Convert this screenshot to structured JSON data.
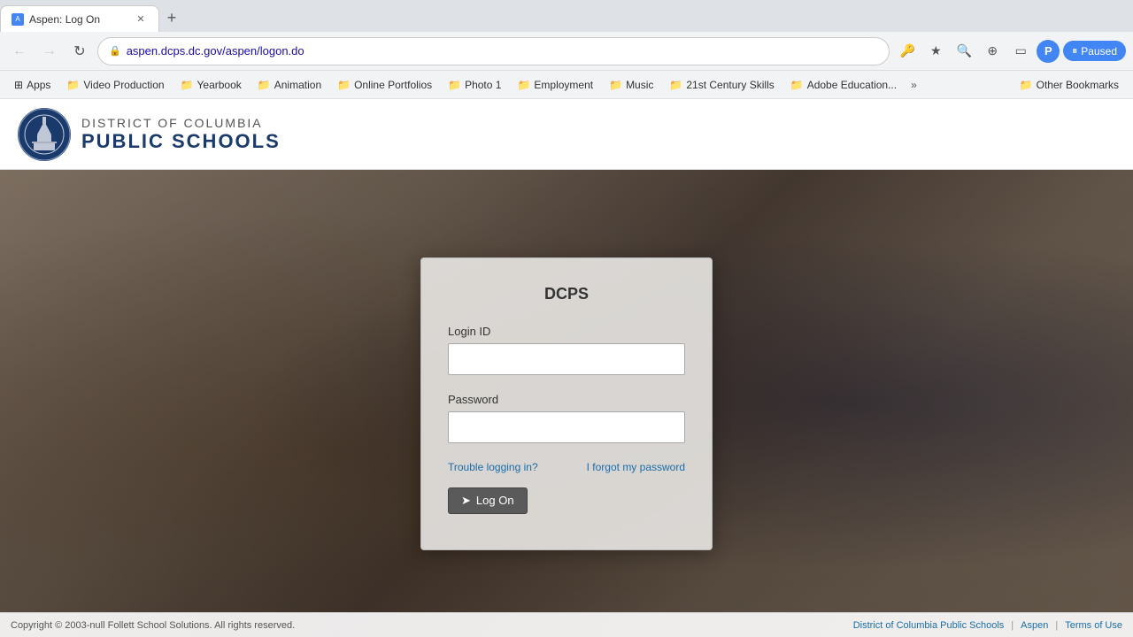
{
  "browser": {
    "tab": {
      "title": "Aspen: Log On",
      "favicon_text": "A"
    },
    "url": "aspen.dcps.dc.gov/aspen/logon.do",
    "new_tab_label": "+",
    "back_disabled": true,
    "forward_disabled": true,
    "paused_label": "Paused"
  },
  "bookmarks": [
    {
      "id": "apps",
      "label": "Apps",
      "type": "apps"
    },
    {
      "id": "video-production",
      "label": "Video Production",
      "type": "folder"
    },
    {
      "id": "yearbook",
      "label": "Yearbook",
      "type": "folder"
    },
    {
      "id": "animation",
      "label": "Animation",
      "type": "folder"
    },
    {
      "id": "online-portfolios",
      "label": "Online Portfolios",
      "type": "folder"
    },
    {
      "id": "photo-1",
      "label": "Photo 1",
      "type": "folder"
    },
    {
      "id": "employment",
      "label": "Employment",
      "type": "folder"
    },
    {
      "id": "music",
      "label": "Music",
      "type": "folder"
    },
    {
      "id": "21st-century-skills",
      "label": "21st Century Skills",
      "type": "folder"
    },
    {
      "id": "adobe-education",
      "label": "Adobe Education...",
      "type": "folder"
    }
  ],
  "other_bookmarks_label": "Other Bookmarks",
  "header": {
    "org_line1": "DISTRICT OF COLUMBIA",
    "org_line2": "PUBLIC SCHOOLS"
  },
  "login": {
    "title": "DCPS",
    "login_id_label": "Login ID",
    "password_label": "Password",
    "trouble_link": "Trouble logging in?",
    "forgot_link": "I forgot my password",
    "logon_button": "Log On"
  },
  "footer": {
    "copyright": "Copyright © 2003-null Follett School Solutions. All rights reserved.",
    "link1": "District of Columbia Public Schools",
    "separator1": "|",
    "link2": "Aspen",
    "separator2": "|",
    "link3": "Terms of Use"
  }
}
